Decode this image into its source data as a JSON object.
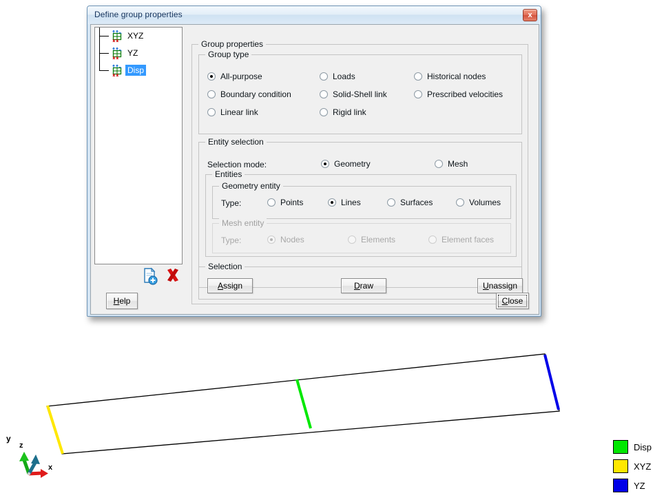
{
  "dialog": {
    "title": "Define group properties",
    "close_icon": "window-close-icon",
    "close_glyph": "x"
  },
  "tree": {
    "items": [
      {
        "label": "XYZ",
        "selected": false,
        "icon": "group-mesh-icon"
      },
      {
        "label": "YZ",
        "selected": false,
        "icon": "group-mesh-icon"
      },
      {
        "label": "Disp",
        "selected": true,
        "icon": "group-mesh-icon"
      }
    ],
    "tools": [
      {
        "name": "new-group-icon",
        "tooltip": "New group"
      },
      {
        "name": "delete-group-icon",
        "tooltip": "Delete group"
      }
    ]
  },
  "group_properties": {
    "title": "Group properties",
    "group_type": {
      "title": "Group type",
      "options": [
        {
          "label": "All-purpose",
          "selected": true
        },
        {
          "label": "Loads",
          "selected": false
        },
        {
          "label": "Historical nodes",
          "selected": false
        },
        {
          "label": "Boundary condition",
          "selected": false
        },
        {
          "label": "Solid-Shell link",
          "selected": false
        },
        {
          "label": "Prescribed velocities",
          "selected": false
        },
        {
          "label": "Linear link",
          "selected": false
        },
        {
          "label": "Rigid link",
          "selected": false
        }
      ]
    },
    "entity_selection": {
      "title": "Entity selection",
      "selection_mode_label": "Selection mode:",
      "modes": [
        {
          "label": "Geometry",
          "selected": true
        },
        {
          "label": "Mesh",
          "selected": false
        }
      ],
      "entities": {
        "title": "Entities",
        "geometry_entity": {
          "title": "Geometry entity",
          "type_label": "Type:",
          "enabled": true,
          "options": [
            {
              "label": "Points",
              "selected": false
            },
            {
              "label": "Lines",
              "selected": true
            },
            {
              "label": "Surfaces",
              "selected": false
            },
            {
              "label": "Volumes",
              "selected": false
            }
          ]
        },
        "mesh_entity": {
          "title": "Mesh entity",
          "type_label": "Type:",
          "enabled": false,
          "options": [
            {
              "label": "Nodes",
              "selected": true
            },
            {
              "label": "Elements",
              "selected": false
            },
            {
              "label": "Element faces",
              "selected": false
            }
          ]
        }
      }
    },
    "selection": {
      "title": "Selection",
      "assign_label": "Assign",
      "assign_mnemonic": "A",
      "draw_label": "Draw",
      "draw_mnemonic": "D",
      "unassign_label": "Unassign",
      "unassign_mnemonic": "U"
    }
  },
  "footer": {
    "help_label": "Help",
    "help_mnemonic": "H",
    "close_label": "Close",
    "close_mnemonic": "C",
    "close_focused": true
  },
  "viewport": {
    "axis_triad": {
      "x_label": "x",
      "y_label": "y",
      "z_label": "z",
      "x_color": "#e01b1b",
      "y_color": "#14a814",
      "z_color": "#1d6f8c"
    },
    "beam": {
      "outline_color": "#000000",
      "fill_color": "#ffffff",
      "vertices": [
        [
          68,
          590
        ],
        [
          791,
          514
        ],
        [
          812,
          597
        ],
        [
          90,
          659
        ]
      ],
      "marked_lines": [
        {
          "name": "XYZ",
          "color": "#ffe800",
          "from": [
            69,
            589
          ],
          "to": [
            91,
            659
          ]
        },
        {
          "name": "Disp",
          "color": "#00e800",
          "from": [
            431,
            551
          ],
          "to": [
            451,
            622
          ]
        },
        {
          "name": "YZ",
          "color": "#0000e8",
          "from": [
            791,
            515
          ],
          "to": [
            811,
            595
          ]
        }
      ]
    }
  },
  "legend": {
    "entries": [
      {
        "label": "Disp",
        "color": "#00e800"
      },
      {
        "label": "XYZ",
        "color": "#ffe800"
      },
      {
        "label": "YZ",
        "color": "#0000e8"
      }
    ]
  }
}
